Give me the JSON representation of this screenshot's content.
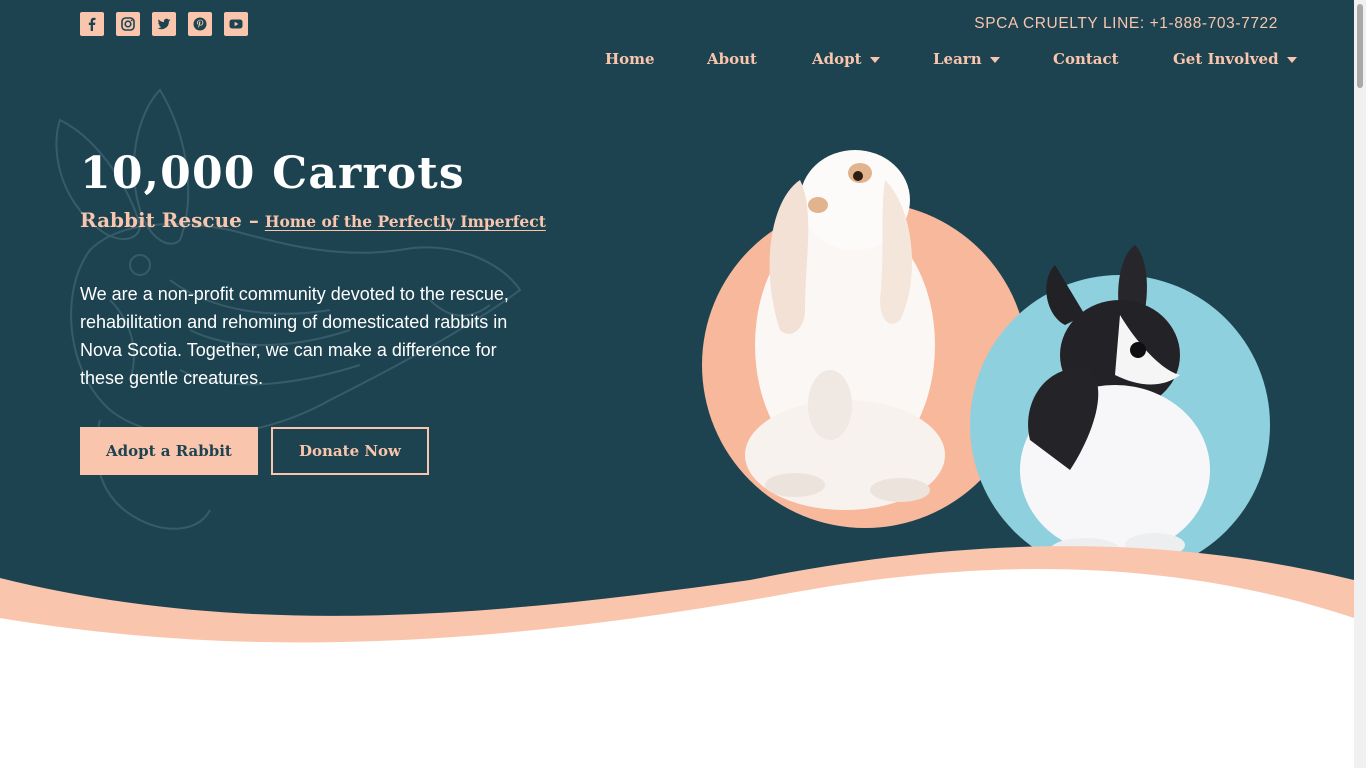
{
  "header": {
    "social": [
      {
        "name": "facebook",
        "icon": "facebook-icon"
      },
      {
        "name": "instagram",
        "icon": "instagram-icon"
      },
      {
        "name": "twitter",
        "icon": "twitter-icon"
      },
      {
        "name": "pinterest",
        "icon": "pinterest-icon"
      },
      {
        "name": "youtube",
        "icon": "youtube-icon"
      }
    ],
    "cruelty_line": "SPCA CRUELTY LINE: +1-888-703-7722"
  },
  "nav": {
    "items": [
      {
        "label": "Home",
        "has_dropdown": false
      },
      {
        "label": "About",
        "has_dropdown": false
      },
      {
        "label": "Adopt",
        "has_dropdown": true
      },
      {
        "label": "Learn",
        "has_dropdown": true
      },
      {
        "label": "Contact",
        "has_dropdown": false
      },
      {
        "label": "Get Involved",
        "has_dropdown": true
      }
    ]
  },
  "hero": {
    "title": "10,000 Carrots",
    "subtitle_prefix": "Rabbit Rescue –",
    "subtitle_link": "Home of the Perfectly Imperfect",
    "description": "We are a non-profit community devoted to the rescue, rehabilitation and rehoming of domesticated rabbits in Nova Scotia. Together, we can make a difference for these gentle creatures.",
    "primary_button": "Adopt a Rabbit",
    "secondary_button": "Donate Now"
  },
  "colors": {
    "background": "#1d4351",
    "accent": "#f9c6ad",
    "circle_peach": "#f7b89b",
    "circle_blue": "#8fd0de"
  }
}
